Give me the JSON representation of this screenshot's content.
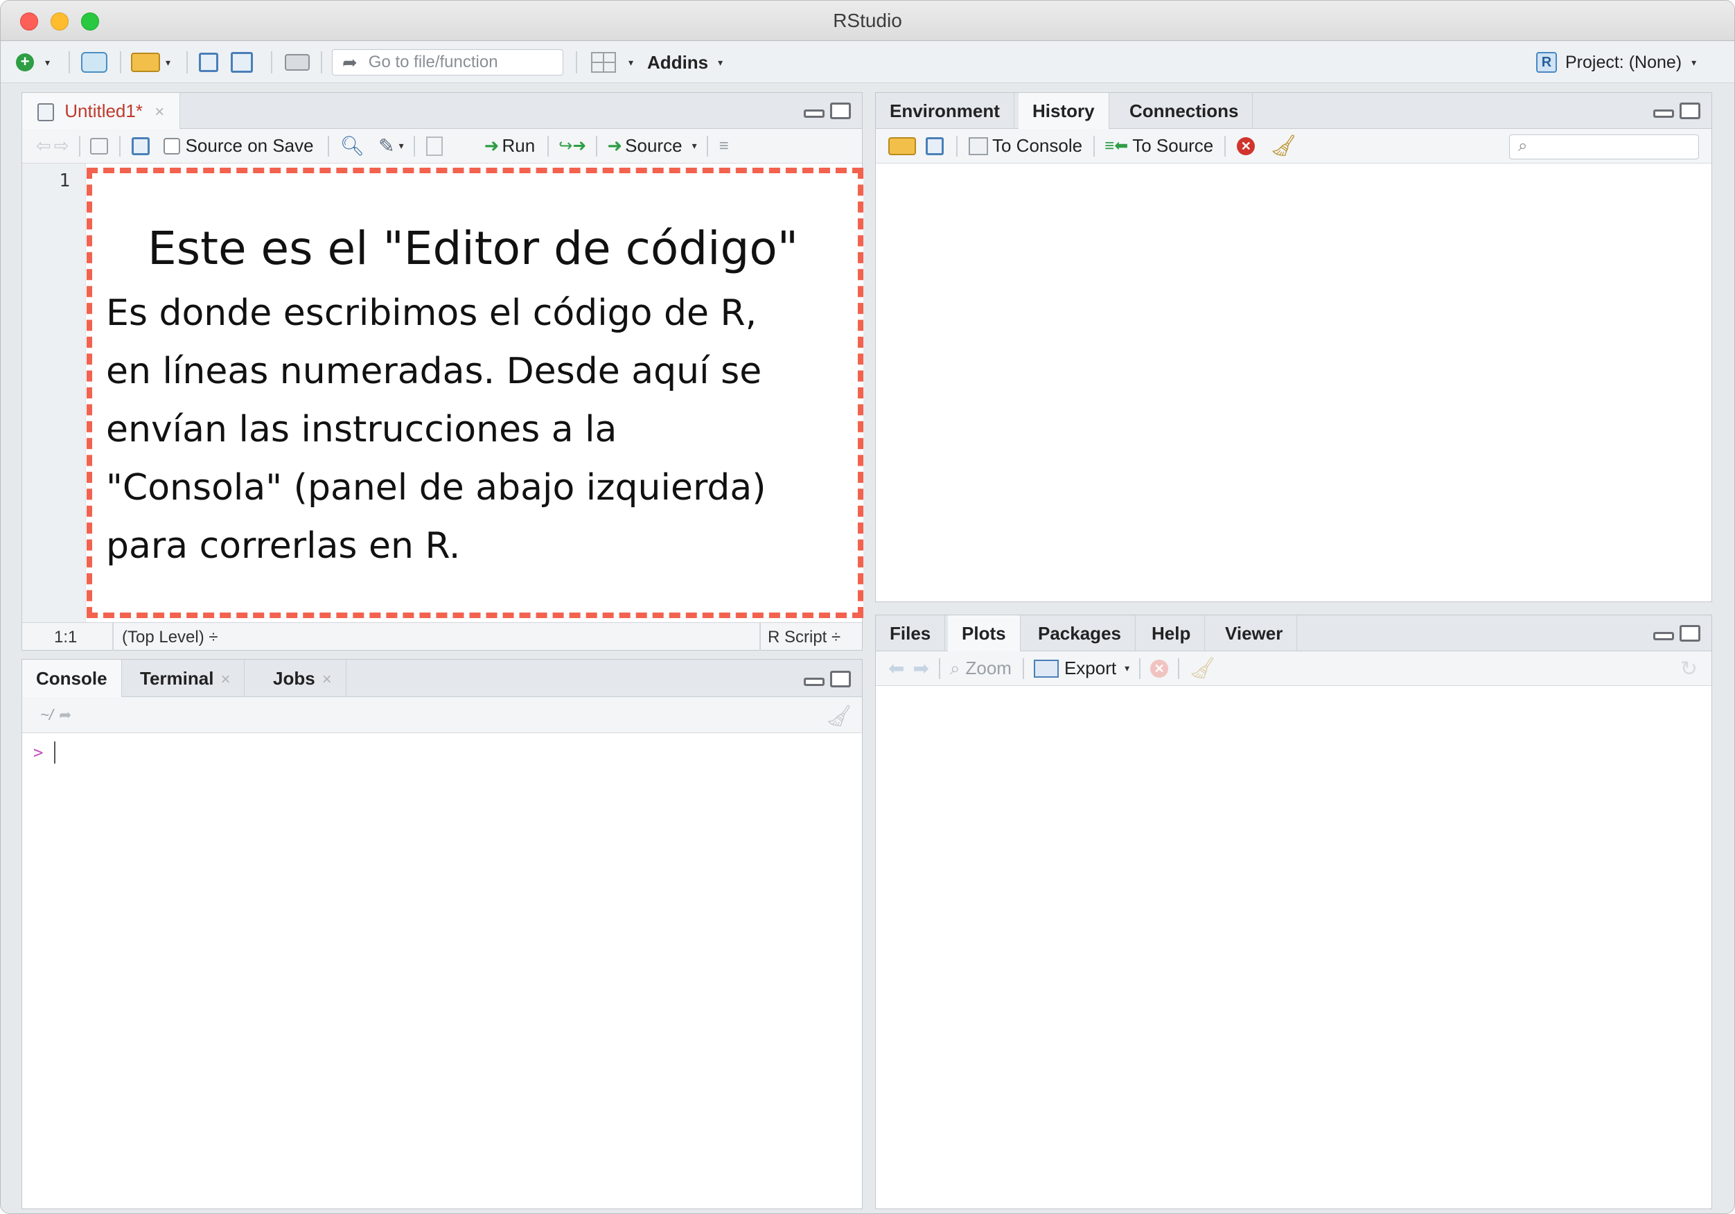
{
  "window": {
    "title": "RStudio"
  },
  "toolbar": {
    "goto_placeholder": "Go to file/function",
    "addins_label": "Addins",
    "project_label": "Project: (None)"
  },
  "source_pane": {
    "tab_label": "Untitled1*",
    "source_on_save": "Source on Save",
    "run_label": "Run",
    "source_label": "Source",
    "line_number": "1",
    "status_pos": "1:1",
    "status_scope": "(Top Level) ÷",
    "status_type": "R Script ÷"
  },
  "annotation": {
    "heading": "Este es el \"Editor de código\"",
    "lines": [
      "Es donde escribimos el código de R,",
      "en líneas numeradas. Desde aquí se",
      "envían las instrucciones a la",
      "\"Consola\" (panel de abajo izquierda)",
      "para correrlas en R."
    ]
  },
  "console_pane": {
    "tabs": [
      "Console",
      "Terminal",
      "Jobs"
    ],
    "path": "~/",
    "prompt": ">"
  },
  "env_pane": {
    "tabs": [
      "Environment",
      "History",
      "Connections"
    ],
    "to_console": "To Console",
    "to_source": "To Source"
  },
  "files_pane": {
    "tabs": [
      "Files",
      "Plots",
      "Packages",
      "Help",
      "Viewer"
    ],
    "zoom_label": "Zoom",
    "export_label": "Export"
  },
  "colors": {
    "annotation_border": "#f2624e",
    "prompt": "#c44fc0",
    "tab_title": "#c0392b"
  }
}
